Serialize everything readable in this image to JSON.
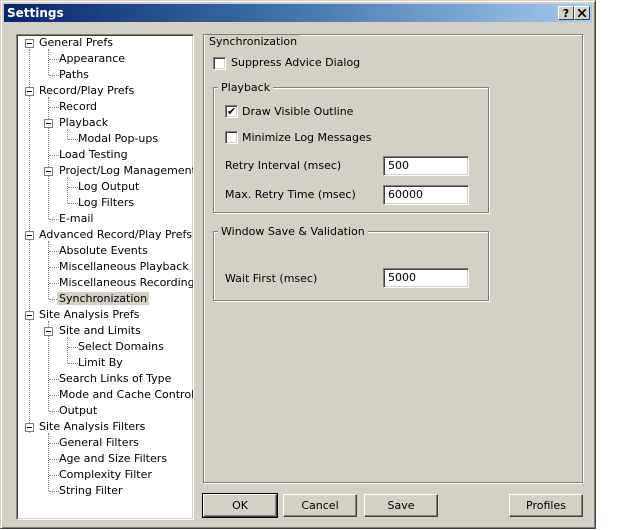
{
  "window": {
    "title": "Settings",
    "help_glyph": "?",
    "close_glyph": "X"
  },
  "tree": {
    "items": [
      {
        "label": "General Prefs"
      },
      {
        "label": "Appearance"
      },
      {
        "label": "Paths"
      },
      {
        "label": "Record/Play Prefs"
      },
      {
        "label": "Record"
      },
      {
        "label": "Playback"
      },
      {
        "label": "Modal Pop-ups"
      },
      {
        "label": "Load Testing"
      },
      {
        "label": "Project/Log Management"
      },
      {
        "label": "Log Output"
      },
      {
        "label": "Log Filters"
      },
      {
        "label": "E-mail"
      },
      {
        "label": "Advanced Record/Play Prefs"
      },
      {
        "label": "Absolute Events"
      },
      {
        "label": "Miscellaneous Playback"
      },
      {
        "label": "Miscellaneous Recording"
      },
      {
        "label": "Synchronization"
      },
      {
        "label": "Site Analysis Prefs"
      },
      {
        "label": "Site and Limits"
      },
      {
        "label": "Select Domains"
      },
      {
        "label": "Limit By"
      },
      {
        "label": "Search Links of Type"
      },
      {
        "label": "Mode and Cache Control"
      },
      {
        "label": "Output"
      },
      {
        "label": "Site Analysis Filters"
      },
      {
        "label": "General Filters"
      },
      {
        "label": "Age and Size Filters"
      },
      {
        "label": "Complexity Filter"
      },
      {
        "label": "String Filter"
      }
    ],
    "selected": "Synchronization"
  },
  "panel": {
    "title": "Synchronization",
    "suppress_advice": {
      "label": "Suppress Advice Dialog",
      "checked": false
    },
    "playback_group": {
      "title": "Playback",
      "draw_outline": {
        "label": "Draw Visible Outline",
        "checked": true,
        "mark": "✔"
      },
      "minimize_log": {
        "label": "Minimize Log Messages",
        "checked": false
      },
      "retry_interval": {
        "label": "Retry Interval (msec)",
        "value": "500"
      },
      "max_retry": {
        "label": "Max. Retry Time (msec)",
        "value": "60000"
      }
    },
    "window_group": {
      "title": "Window Save & Validation",
      "wait_first": {
        "label": "Wait First (msec)",
        "value": "5000"
      }
    }
  },
  "buttons": {
    "ok": "OK",
    "cancel": "Cancel",
    "save": "Save",
    "profiles": "Profiles"
  }
}
